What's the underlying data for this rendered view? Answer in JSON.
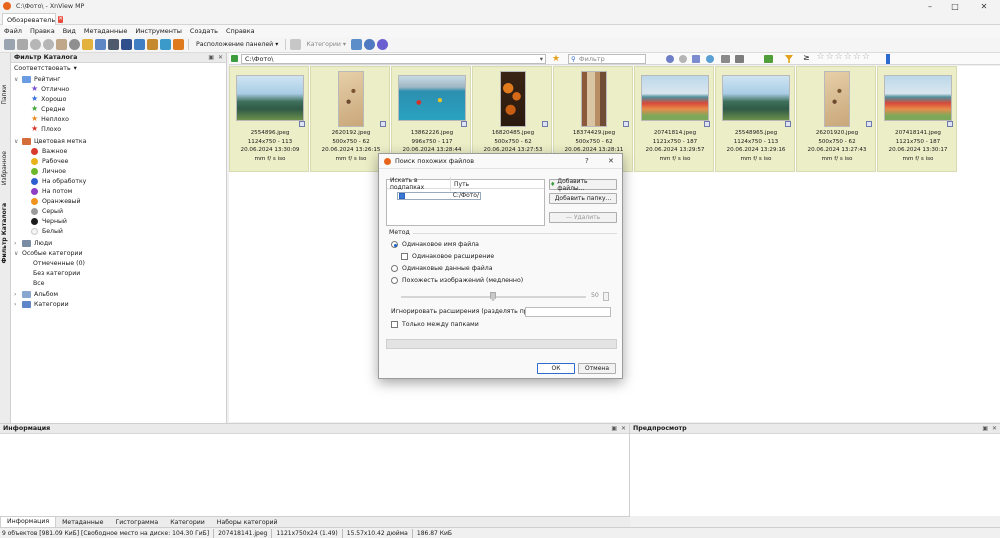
{
  "window": {
    "title": "C:\\Фото\\ - XnView MP"
  },
  "tabs": [
    {
      "label": "Обозреватель"
    }
  ],
  "menu": [
    "Файл",
    "Правка",
    "Вид",
    "Метаданные",
    "Инструменты",
    "Создать",
    "Справка"
  ],
  "toolbar": {
    "panel_layout": "Расположение панелей",
    "categories": "Категории"
  },
  "sidebar_tabs": [
    "Папки",
    "Избранное",
    "Фильтр Каталога"
  ],
  "catalog_filter": {
    "title": "Фильтр Каталога",
    "match": "Соответствовать",
    "rating_label": "Рейтинг",
    "ratings": [
      {
        "label": "Отлично",
        "color": "#7b4fd4"
      },
      {
        "label": "Хорошо",
        "color": "#2f6fd6"
      },
      {
        "label": "Средне",
        "color": "#3fa535"
      },
      {
        "label": "Неплохо",
        "color": "#e68a1c"
      },
      {
        "label": "Плохо",
        "color": "#d8342c"
      }
    ],
    "color_label": "Цветовая метка",
    "colors": [
      {
        "label": "Важное",
        "color": "#d93a2b"
      },
      {
        "label": "Рабочее",
        "color": "#e9b21a"
      },
      {
        "label": "Личное",
        "color": "#6bb82b"
      },
      {
        "label": "На обработку",
        "color": "#2e5fd1"
      },
      {
        "label": "На потом",
        "color": "#8e3dc7"
      },
      {
        "label": "Оранжевый",
        "color": "#f0931d"
      },
      {
        "label": "Серый",
        "color": "#9b9b9b"
      },
      {
        "label": "Черный",
        "color": "#1c1c1c"
      },
      {
        "label": "Белый",
        "color": "#f4f4f4"
      }
    ],
    "people": "Люди",
    "special": "Особые категории",
    "special_items": [
      "Отмеченные (0)",
      "Без категории",
      "Все"
    ],
    "album": "Альбом",
    "categories": "Категории"
  },
  "address": {
    "path": "C:\\Фото\\",
    "filter_placeholder": "Фильтр",
    "rating_op": "≥"
  },
  "thumbnails": [
    {
      "name": "2554896.jpeg",
      "dims": "1124x750 - 113",
      "date": "20.06.2024 13:30:09",
      "exif": "mm f/ s iso",
      "scene": "mountain"
    },
    {
      "name": "2620192.jpeg",
      "dims": "500x750 - 62",
      "date": "20.06.2024 13:26:15",
      "exif": "mm f/ s iso",
      "scene": "sand"
    },
    {
      "name": "13862226.jpeg",
      "dims": "996x750 - 117",
      "date": "20.06.2024 13:28:44",
      "exif": "mm f/ s iso",
      "scene": "boats"
    },
    {
      "name": "16820485.jpeg",
      "dims": "500x750 - 62",
      "date": "20.06.2024 13:27:53",
      "exif": "mm f/ s iso",
      "scene": "fruit"
    },
    {
      "name": "18374429.jpeg",
      "dims": "500x750 - 62",
      "date": "20.06.2024 13:28:11",
      "exif": "mm f/ s iso",
      "scene": "street"
    },
    {
      "name": "20741814.jpeg",
      "dims": "1121x750 - 187",
      "date": "20.06.2024 13:29:57",
      "exif": "mm f/ s iso",
      "scene": "flowers"
    },
    {
      "name": "25548965.jpeg",
      "dims": "1124x750 - 113",
      "date": "20.06.2024 13:29:16",
      "exif": "mm f/ s iso",
      "scene": "mountain"
    },
    {
      "name": "26201920.jpeg",
      "dims": "500x750 - 62",
      "date": "20.06.2024 13:27:43",
      "exif": "mm f/ s iso",
      "scene": "sand"
    },
    {
      "name": "207418141.jpeg",
      "dims": "1121x750 - 187",
      "date": "20.06.2024 13:30:17",
      "exif": "mm f/ s iso",
      "scene": "flowers"
    }
  ],
  "dialog": {
    "title": "Поиск похожих файлов",
    "help": "?",
    "col_subfolders": "Искать в подпапках",
    "col_path": "Путь",
    "row_path": "C:/Фото/",
    "add_files": "Добавить файлы...",
    "add_folder": "Добавить папку...",
    "delete": "Удалить",
    "method": "Метод",
    "opt_same_name": "Одинаковое имя файла",
    "opt_same_ext": "Одинаковое расширение",
    "opt_same_data": "Одинаковые данные файла",
    "opt_similar": "Похожесть изображений (медленно)",
    "similarity": "50",
    "ignore_ext": "Игнорировать расширения (разделять пробелом)",
    "between_folders": "Только между папками",
    "ok": "ОК",
    "cancel": "Отмена"
  },
  "info_panel": {
    "title": "Информация"
  },
  "preview_panel": {
    "title": "Предпросмотр"
  },
  "bottom_tabs": [
    "Информация",
    "Метаданные",
    "Гистограмма",
    "Категории",
    "Наборы категорий"
  ],
  "status": [
    "9 объектов [981.09 КиБ] [Свободное место на диске: 104.30 ГиБ]",
    "207418141.jpeg",
    "1121x750x24 (1.49)",
    "15.57x10.42 дюйма",
    "186.87 КиБ"
  ]
}
